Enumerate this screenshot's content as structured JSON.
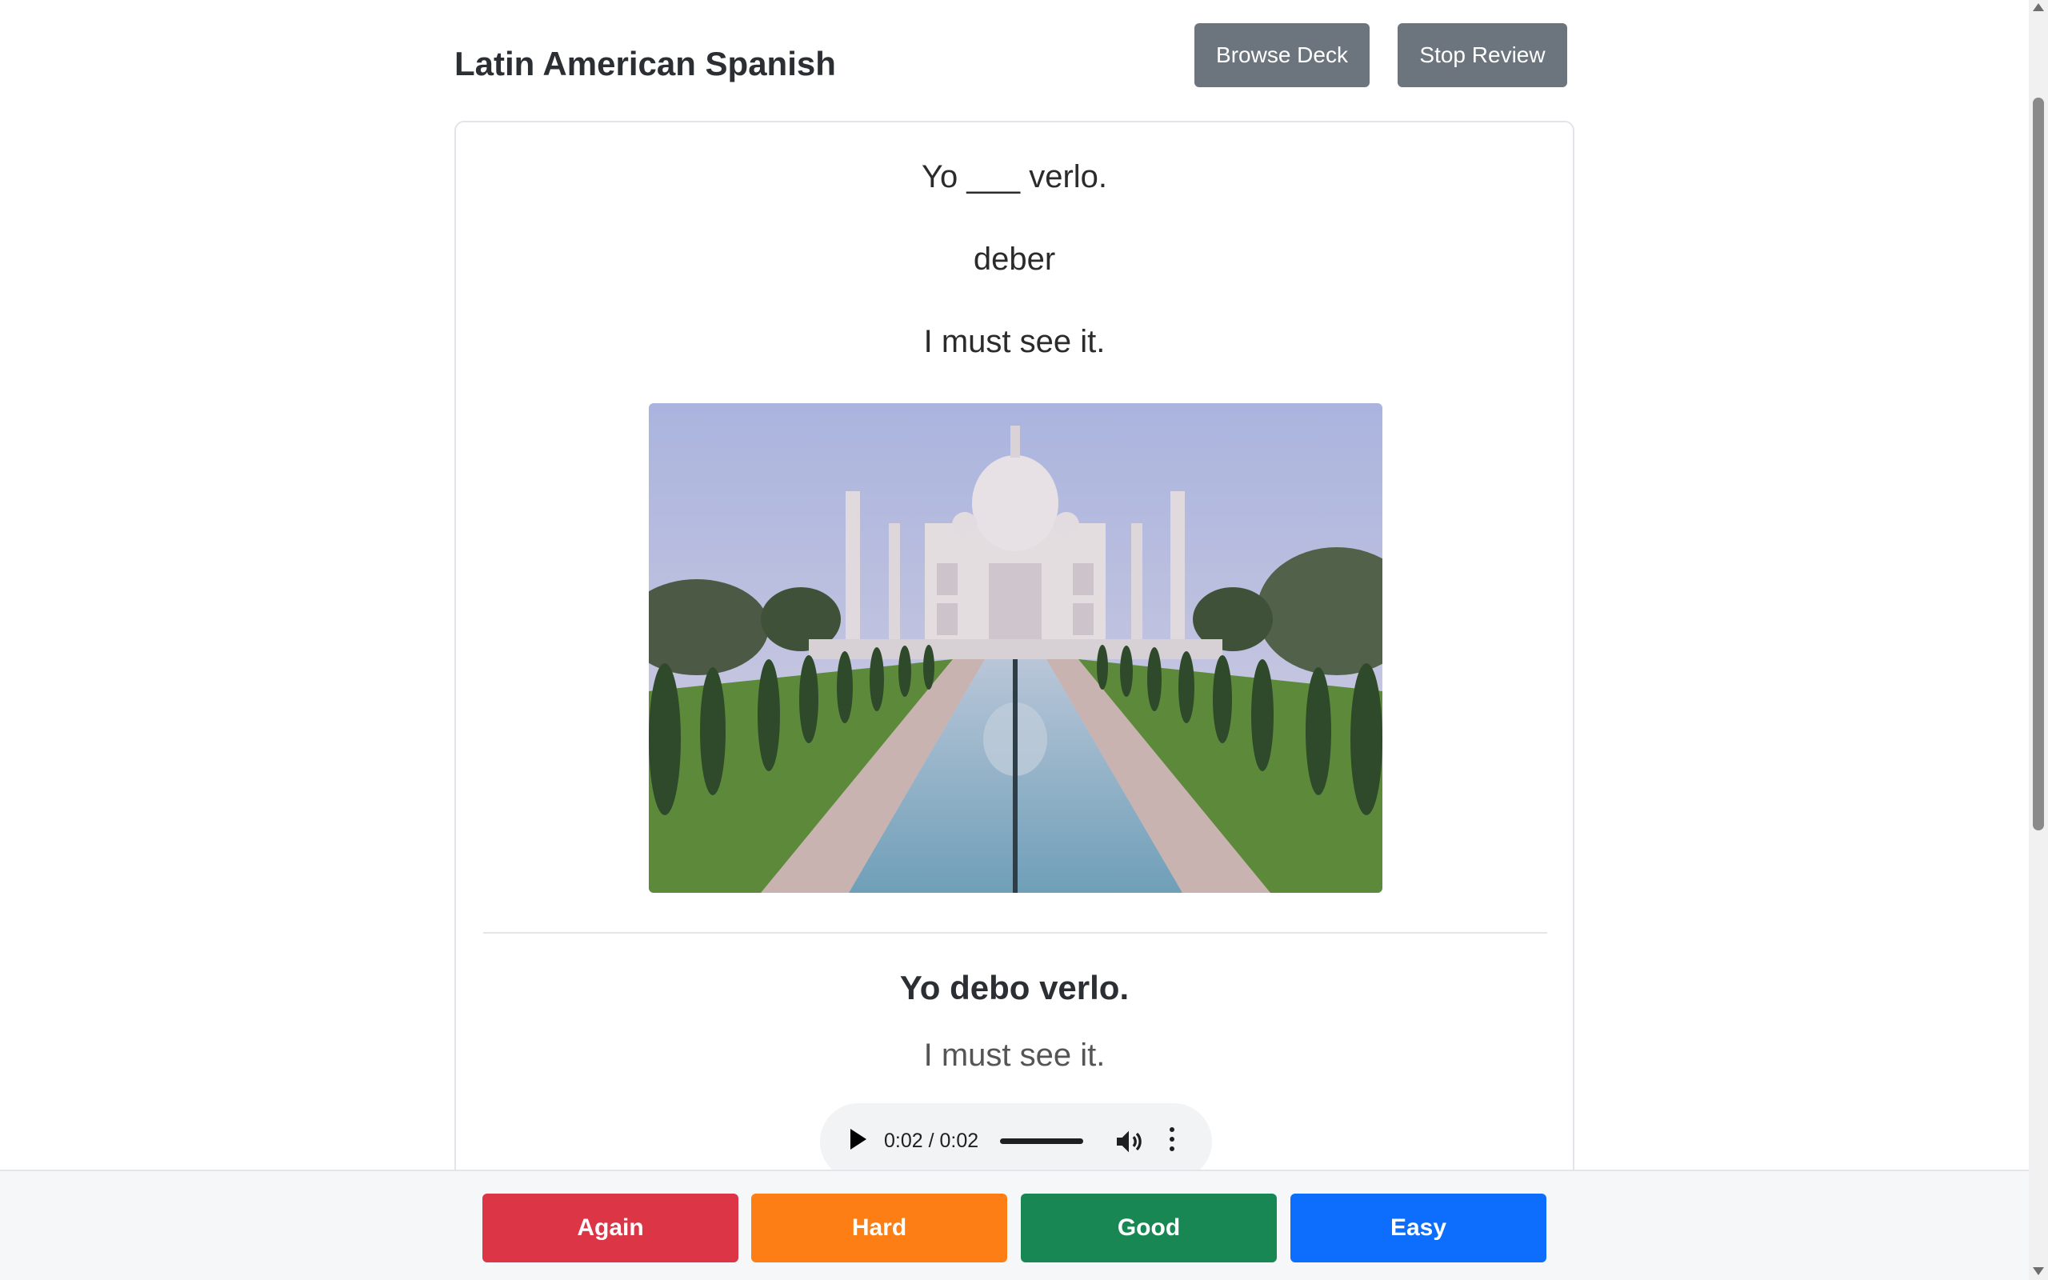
{
  "header": {
    "deck_title": "Latin American Spanish",
    "browse_label": "Browse Deck",
    "stop_label": "Stop Review"
  },
  "card": {
    "front": {
      "sentence": "Yo ___ verlo.",
      "word": "deber",
      "translation": "I must see it."
    },
    "back": {
      "sentence": "Yo debo verlo.",
      "translation": "I must see it."
    },
    "audio": {
      "time": "0:02 / 0:02",
      "progress": 1.0
    }
  },
  "answers": {
    "again": "Again",
    "hard": "Hard",
    "good": "Good",
    "easy": "Easy"
  },
  "colors": {
    "again": "#dc3545",
    "hard": "#fd7e14",
    "good": "#198754",
    "easy": "#0d6efd",
    "secondary": "#6c757d"
  },
  "icons": [
    "play-icon",
    "volume-icon",
    "more-vertical-icon",
    "scroll-up-icon",
    "scroll-down-icon"
  ]
}
